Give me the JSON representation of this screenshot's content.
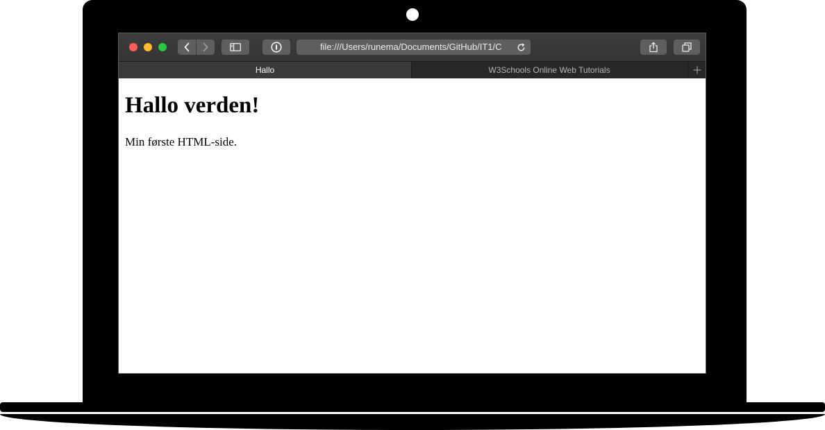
{
  "browser": {
    "address": {
      "url": "file:///Users/runema/Documents/GitHub/IT1/C"
    },
    "tabs": [
      {
        "label": "Hallo",
        "active": true
      },
      {
        "label": "W3Schools Online Web Tutorials",
        "active": false
      }
    ],
    "icons": {
      "back": "chevron-left",
      "forward": "chevron-right",
      "sidebar": "sidebar-toggle",
      "password": "1password",
      "reload": "reload",
      "share": "share",
      "tabs": "tab-overview",
      "new_tab": "plus"
    },
    "colors": {
      "close": "#fe5f57",
      "minimize": "#febc2e",
      "zoom": "#28c840"
    }
  },
  "page": {
    "heading": "Hallo verden!",
    "paragraph": "Min første HTML-side."
  }
}
